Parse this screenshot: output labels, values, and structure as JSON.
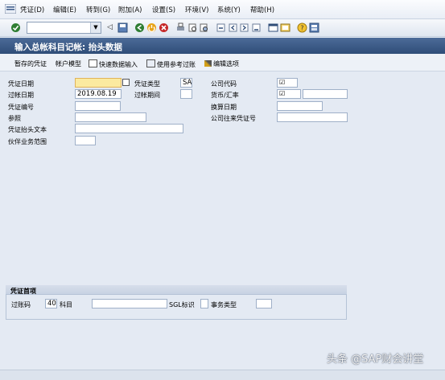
{
  "menu": {
    "items": [
      "凭证(D)",
      "编辑(E)",
      "转到(G)",
      "附加(A)",
      "设置(S)",
      "环境(V)",
      "系统(Y)",
      "帮助(H)"
    ]
  },
  "screen": {
    "title": "输入总帐科目记帐: 抬头数据"
  },
  "app_toolbar": {
    "buttons": [
      "暂存的凭证",
      "帐户模型",
      "快速数据输入",
      "使用参考过账",
      "编辑选项"
    ]
  },
  "header_form": {
    "doc_date_label": "凭证日期",
    "posting_date_label": "过帐日期",
    "posting_date_value": "2019.08.19",
    "doc_number_label": "凭证编号",
    "reference_label": "参照",
    "header_text_label": "凭证抬头文本",
    "partner_ba_label": "伙伴业务范围",
    "doc_type_label": "凭证类型",
    "doc_type_value": "SA",
    "period_label": "过帐期间",
    "company_code_label": "公司代码",
    "currency_label": "货币/汇率",
    "translation_date_label": "换算日期",
    "intercompany_label": "公司往来凭证号"
  },
  "first_line_item": {
    "group_title": "凭证首项",
    "posting_key_label": "过账码",
    "posting_key_value": "40",
    "account_label": "科目",
    "sgl_label": "SGL标识",
    "trans_type_label": "事务类型"
  },
  "watermark": {
    "text": "头条 @SAP财会讲堂"
  },
  "colors": {
    "title_bar": "#34527d",
    "background": "#e4eaf3",
    "required_field": "#fbeaa0"
  }
}
